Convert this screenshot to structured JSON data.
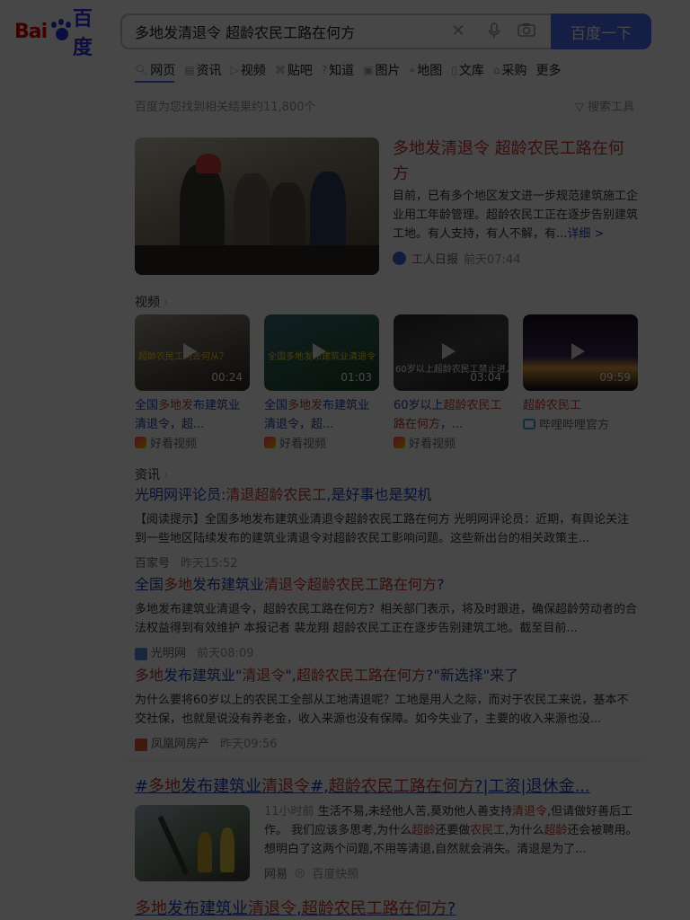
{
  "header": {
    "logo_left": "Bai",
    "logo_right": "百度",
    "search_value": "多地发清退令 超龄农民工路在何方",
    "search_button": "百度一下"
  },
  "tabs": [
    {
      "label": "网页"
    },
    {
      "label": "资讯"
    },
    {
      "label": "视频"
    },
    {
      "label": "贴吧"
    },
    {
      "label": "知道"
    },
    {
      "label": "图片"
    },
    {
      "label": "地图"
    },
    {
      "label": "文库"
    },
    {
      "label": "采购"
    },
    {
      "label": "更多"
    }
  ],
  "result_count": "百度为您找到相关结果约11,800个",
  "search_tools": "搜索工具",
  "hero": {
    "title": "多地发清退令 超龄农民工路在何方",
    "desc": "目前，已有多个地区发文进一步规范建筑施工企业用工年龄管理。超龄农民工正在逐步告别建筑工地。有人支持，有人不解，有...",
    "more": "详细 >",
    "source": "工人日报",
    "time": "前天07:44"
  },
  "video_section": "视频",
  "videos": [
    {
      "caption": "超龄农民工何去何从？",
      "duration": "00:24",
      "title_a": "全国",
      "title_hl": "多地发",
      "title_b": "布建筑业",
      "title_line2_hl": "清退令",
      "title_line2": "，超...",
      "source": "好看视频"
    },
    {
      "caption": "全国多地发布建筑业清退令",
      "duration": "01:03",
      "title_a": "全国",
      "title_hl": "多地发",
      "title_b": "布建筑业",
      "title_line2_hl": "清退令",
      "title_line2": "，超...",
      "source": "好看视频"
    },
    {
      "caption": "60岁以上超龄农民工禁止进入",
      "duration": "03:04",
      "title_a": "60岁以上",
      "title_hl": "超龄农民工",
      "title_b": "",
      "title_line2_hl": "路在何方",
      "title_line2": "，...",
      "source": "好看视频"
    },
    {
      "caption": "",
      "duration": "09:59",
      "title_a": "",
      "title_hl": "超龄农民工",
      "title_b": "",
      "title_line2_hl": "",
      "title_line2": "",
      "source": "哔哩哔哩官方"
    }
  ],
  "news_section": "资讯",
  "news": [
    {
      "title_a": "光明网评论员:",
      "title_hl": "清退超龄农民工",
      "title_b": ",是好事也是契机",
      "desc": "【阅读提示】全国多地发布建筑业清退令超龄农民工路在何方 光明网评论员：近期，有舆论关注到一些地区陆续发布的建筑业清退令对超龄农民工影响问题。这些新出台的相关政策主...",
      "source": "百家号",
      "time": "昨天15:52"
    },
    {
      "title_a": "全国",
      "title_hl": "多地",
      "title_b": "发布建筑业",
      "title_hl2": "清退令超龄农民工路在何方",
      "title_c": "?",
      "desc": "多地发布建筑业清退令，超龄农民工路在何方？相关部门表示，将及时跟进，确保超龄劳动者的合法权益得到有效维护 本报记者 裴龙翔 超龄农民工正在逐步告别建筑工地。截至目前...",
      "source": "光明网",
      "time": "前天08:09"
    },
    {
      "title_a": "",
      "title_hl": "多地",
      "title_b": "发布建筑业\"",
      "title_hl2": "清退令",
      "title_c": "\",",
      "title_hl3": "超龄农民工路在何方",
      "title_d": "?\"新选择\"来了",
      "desc": "为什么要将60岁以上的农民工全部从工地清退呢？工地是用人之际，而对于农民工来说，基本不交社保，也就是说没有养老金，收入来源也没有保障。如今失业了，主要的收入来源也没...",
      "source": "凤凰网房产",
      "time": "昨天09:56"
    }
  ],
  "result2": {
    "title_a": "#",
    "title_hl": "多地",
    "title_b": "发布建筑业",
    "title_hl2": "清退令",
    "title_c": "#,",
    "title_hl3": "超龄农民工路在何方",
    "title_d": "?|工资|退休金...",
    "time": "11小时前",
    "desc_a": "生活不易,未经他人苦,莫劝他人善支持",
    "desc_hl1": "清退令",
    "desc_b": ",但请做好善后工作。 我们应该多思考,为什么",
    "desc_hl2": "超龄",
    "desc_c": "还要做",
    "desc_hl3": "农民工",
    "desc_d": ",为什么",
    "desc_hl4": "超龄",
    "desc_e": "还会被聘用。想明白了这两个问题,不用等清退,自然就会消失。清退是为了...",
    "source": "网易",
    "snapshot": "百度快照"
  },
  "result3": {
    "title_hl": "多地",
    "title_b": "发布建筑业",
    "title_hl2": "清退令",
    "title_c": ",",
    "title_hl3": "超龄农民工路在何方",
    "title_d": "?"
  }
}
